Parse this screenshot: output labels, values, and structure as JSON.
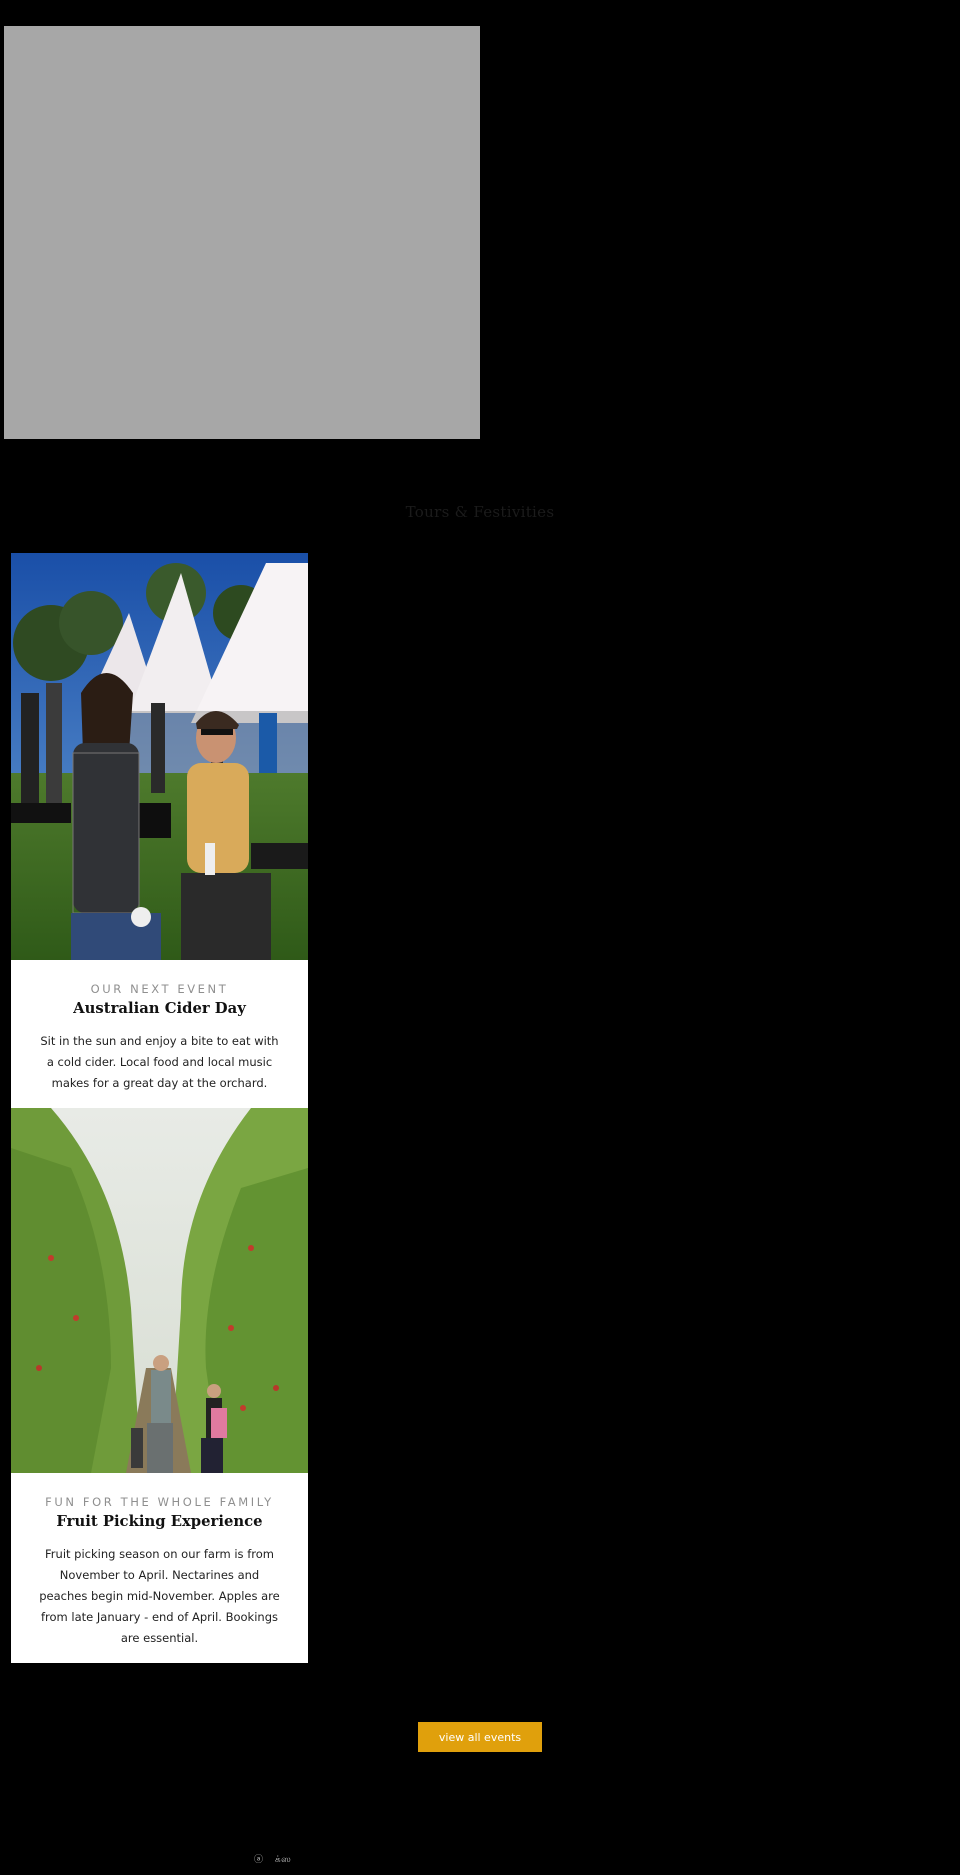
{
  "hero": {
    "media_icon": "image-placeholder"
  },
  "section": {
    "title": "Tours & Festivities"
  },
  "events": [
    {
      "image_icon": "photo-cider-day",
      "eyebrow": "OUR NEXT EVENT",
      "title": "Australian Cider Day",
      "description": "Sit in the sun and enjoy a bite to eat with a cold cider. Local food and local music makes for a great day at the orchard."
    },
    {
      "image_icon": "photo-fruit-picking",
      "eyebrow": "FUN FOR THE WHOLE FAMILY",
      "title": "Fruit Picking Experience",
      "description": "Fruit picking season on our farm is from November to April. Nectarines and peaches begin mid-November. Apples are from late January - end of April. Bookings are essential."
    }
  ],
  "cta": {
    "label": "view all events"
  },
  "footer": {
    "mini_left": "ⓐ",
    "mini_right": "க்ஸ"
  },
  "colors": {
    "background": "#000000",
    "placeholder": "#a7a7a7",
    "card": "#ffffff",
    "accent": "#e0a00c",
    "eyebrow": "#8f8f8f"
  }
}
